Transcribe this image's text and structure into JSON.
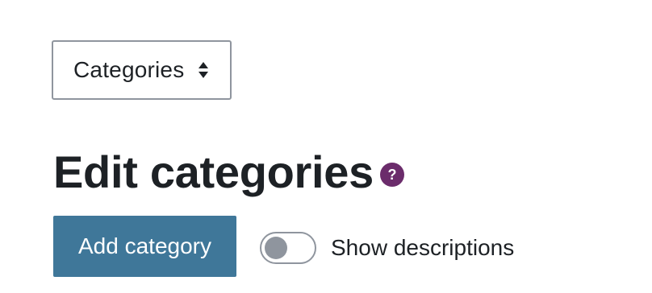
{
  "category_select": {
    "value": "Categories",
    "caret_icon": "sort-arrows-icon"
  },
  "page": {
    "title": "Edit categories",
    "help_icon": "question-circle-icon",
    "help_glyph": "?"
  },
  "actions": {
    "add_category_label": "Add category"
  },
  "show_descriptions": {
    "label": "Show descriptions",
    "checked": false
  },
  "colors": {
    "primary_button": "#3f7799",
    "help_badge": "#6b2c6b",
    "text": "#1d2125",
    "border": "#8f959e"
  }
}
